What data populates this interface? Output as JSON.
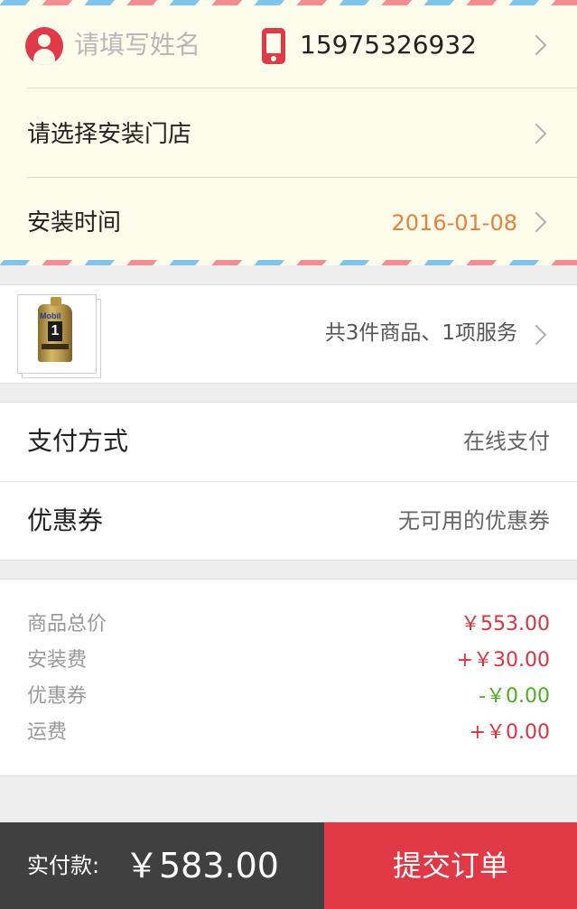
{
  "contact": {
    "name_placeholder": "请填写姓名",
    "phone": "15975326932"
  },
  "store": {
    "label": "请选择安装门店"
  },
  "install_time": {
    "label": "安装时间",
    "date": "2016-01-08"
  },
  "product": {
    "brand": "Mobil",
    "number": "1",
    "summary": "共3件商品、1项服务"
  },
  "payment": {
    "method_label": "支付方式",
    "method_value": "在线支付",
    "coupon_label": "优惠券",
    "coupon_value": "无可用的优惠券"
  },
  "prices": [
    {
      "label": "商品总价",
      "value": "￥553.00",
      "color": "#d9343f"
    },
    {
      "label": "安装费",
      "value": "+￥30.00",
      "color": "#d9343f"
    },
    {
      "label": "优惠券",
      "value": "-￥0.00",
      "color": "#4caf21"
    },
    {
      "label": "运费",
      "value": "+￥0.00",
      "color": "#d9343f"
    }
  ],
  "footer": {
    "paid_label": "实付款:",
    "paid_amount": "￥583.00",
    "submit_label": "提交订单"
  },
  "colors": {
    "accent_red": "#e13846",
    "date_orange": "#e8823a",
    "envelope_bg": "#fefdeb"
  }
}
